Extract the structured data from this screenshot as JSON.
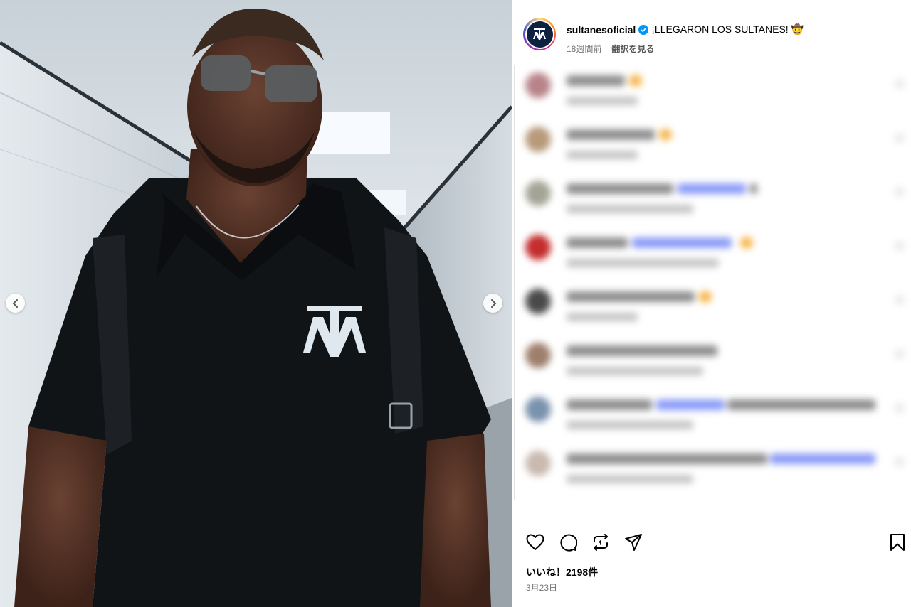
{
  "post": {
    "username": "sultanesoficial",
    "caption": "¡LLEGARON LOS SULTANES! 🤠",
    "time_ago": "18週間前",
    "translate_label": "翻訳を見る",
    "likes_text": "いいね！2198件",
    "date": "3月23日"
  },
  "icons": {
    "avatar": "sultanes-logo-avatar",
    "verified": "verified-badge-icon",
    "prev": "chevron-left-icon",
    "next": "chevron-right-icon",
    "like": "heart-icon",
    "comment": "comment-icon",
    "repost": "repost-icon",
    "share": "share-icon",
    "save": "bookmark-icon"
  },
  "colors": {
    "verified": "#0095f6",
    "brand_navy": "#0d2140",
    "meta_text": "#737373"
  },
  "comments": [
    {
      "avatar_color": "#b8848a"
    },
    {
      "avatar_color": "#b79a7a"
    },
    {
      "avatar_color": "#a4a496"
    },
    {
      "avatar_color": "#c42d2d"
    },
    {
      "avatar_color": "#4a4a4a"
    },
    {
      "avatar_color": "#9e7f6c"
    },
    {
      "avatar_color": "#7a92ad"
    },
    {
      "avatar_color": "#c9b9b0"
    }
  ]
}
